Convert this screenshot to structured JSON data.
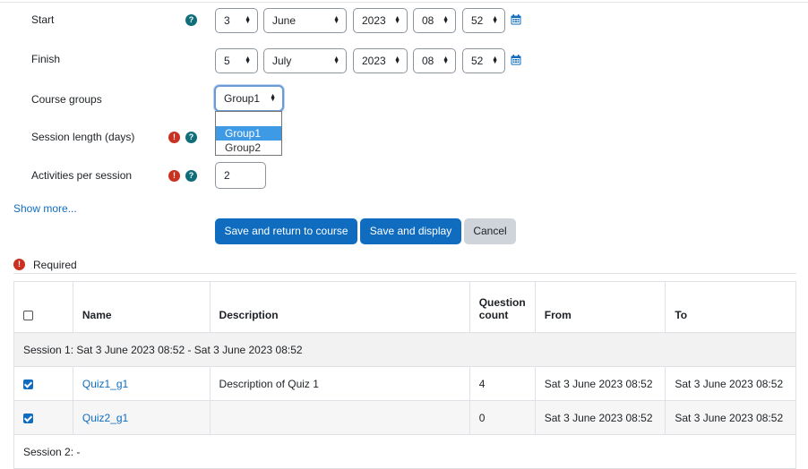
{
  "form": {
    "start": {
      "label": "Start",
      "day": "3",
      "month": "June",
      "year": "2023",
      "hour": "08",
      "minute": "52"
    },
    "finish": {
      "label": "Finish",
      "day": "5",
      "month": "July",
      "year": "2023",
      "hour": "08",
      "minute": "52"
    },
    "course_groups": {
      "label": "Course groups",
      "value": "Group1",
      "options": [
        "",
        "Group1",
        "Group2"
      ],
      "selected_index": 1
    },
    "session_length": {
      "label": "Session length (days)"
    },
    "activities_per_session": {
      "label": "Activities per session",
      "value": "2"
    },
    "show_more": "Show more...",
    "buttons": {
      "save_return": "Save and return to course",
      "save_display": "Save and display",
      "cancel": "Cancel"
    },
    "required_note": "Required"
  },
  "icons": {
    "help": "?",
    "required": "!",
    "select_arrows": "▲▼",
    "calendar": "calendar-icon"
  },
  "colors": {
    "primary": "#0f6cbf",
    "help": "#0f6e7a",
    "required": "#ca3120",
    "dropdown_highlight": "#3f9ae5"
  },
  "table": {
    "headers": {
      "name": "Name",
      "description": "Description",
      "question_count_line1": "Question",
      "question_count_line2": "count",
      "from": "From",
      "to": "To"
    },
    "session1": "Session 1: Sat 3 June 2023 08:52 - Sat 3 June 2023 08:52",
    "rows": [
      {
        "checked": true,
        "name": "Quiz1_g1",
        "description": "Description of Quiz 1",
        "question_count": "4",
        "from": "Sat 3 June 2023 08:52",
        "to": "Sat 3 June 2023 08:52"
      },
      {
        "checked": true,
        "name": "Quiz2_g1",
        "description": "",
        "question_count": "0",
        "from": "Sat 3 June 2023 08:52",
        "to": "Sat 3 June 2023 08:52"
      }
    ],
    "session2": "Session 2: -"
  }
}
